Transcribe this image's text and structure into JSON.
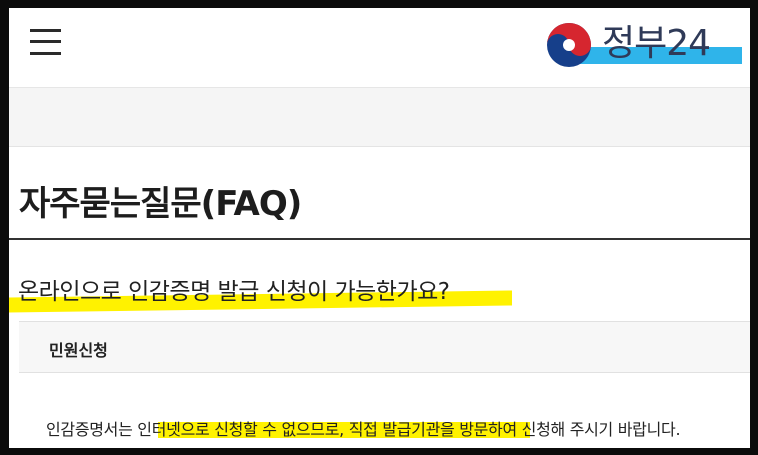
{
  "header": {
    "menu_icon": "hamburger-menu-icon",
    "logo_text": "정부24",
    "logo_emblem": "taegeuk-emblem-icon",
    "colors": {
      "emblem_red": "#d6262f",
      "emblem_blue": "#163f8a",
      "logo_highlight": "#2fb4ea"
    }
  },
  "page": {
    "title": "자주묻는질문(FAQ)"
  },
  "faq": {
    "question": "온라인으로 인감증명 발급 신청이 가능한가요?",
    "category": "민원신청",
    "answer": "인감증명서는 인터넷으로 신청할 수 없으므로, 직접 발급기관을 방문하여 신청해 주시기 바랍니다.",
    "highlight_color": "#fff200"
  }
}
